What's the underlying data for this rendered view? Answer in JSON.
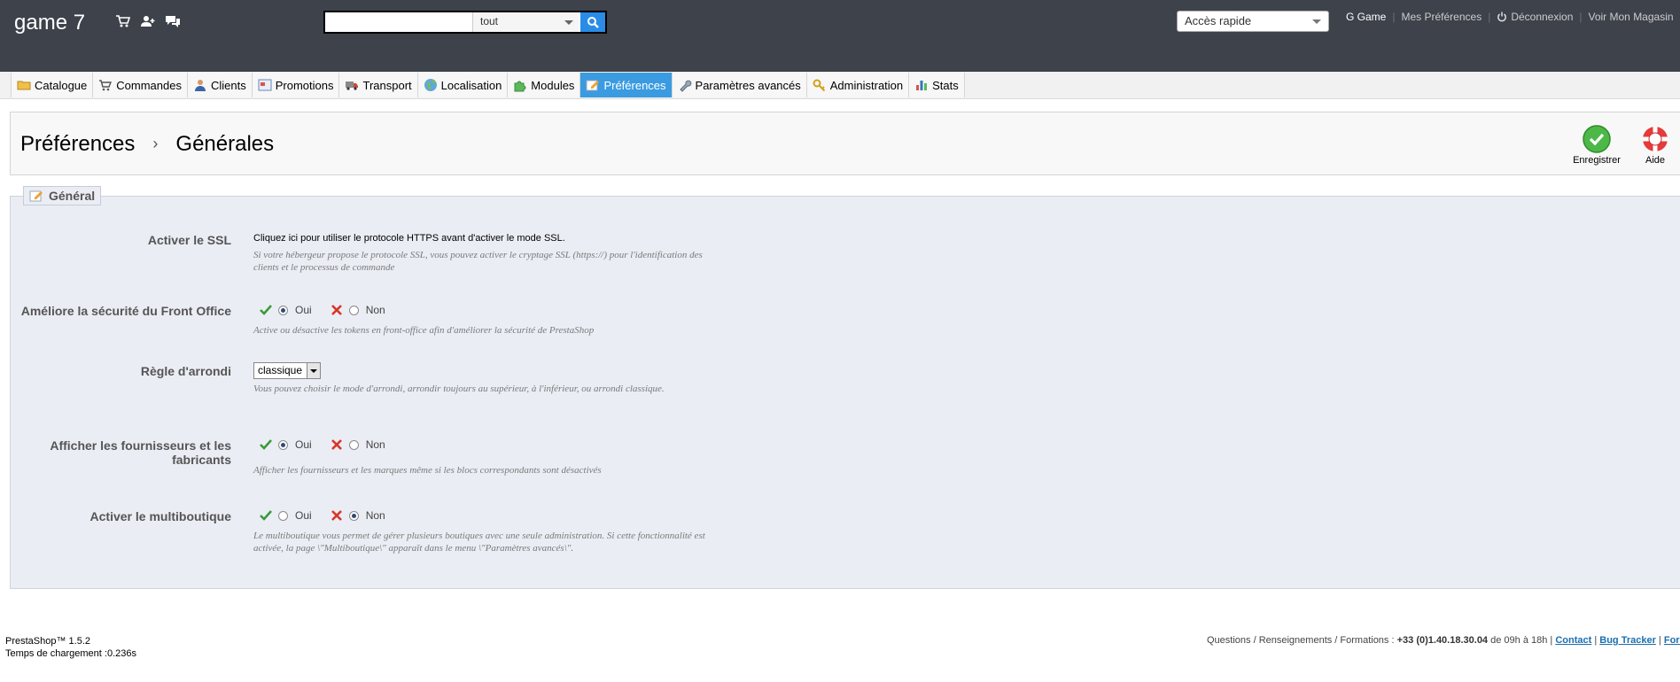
{
  "header": {
    "shop_name": "game 7",
    "search": {
      "value": "",
      "scope": "tout"
    },
    "quick_access": "Accès rapide",
    "links": {
      "user": "G Game",
      "preferences": "Mes Préférences",
      "logout": "Déconnexion",
      "view_shop": "Voir Mon Magasin"
    },
    "icons": [
      "cart-icon",
      "customer-icon",
      "messages-icon"
    ]
  },
  "tabs": [
    {
      "label": "Catalogue",
      "icon": "folder-icon"
    },
    {
      "label": "Commandes",
      "icon": "cart-icon"
    },
    {
      "label": "Clients",
      "icon": "user-icon"
    },
    {
      "label": "Promotions",
      "icon": "promo-icon"
    },
    {
      "label": "Transport",
      "icon": "truck-icon"
    },
    {
      "label": "Localisation",
      "icon": "globe-icon"
    },
    {
      "label": "Modules",
      "icon": "puzzle-icon"
    },
    {
      "label": "Préférences",
      "icon": "preferences-icon",
      "active": true
    },
    {
      "label": "Paramètres avancés",
      "icon": "wrench-icon"
    },
    {
      "label": "Administration",
      "icon": "key-icon"
    },
    {
      "label": "Stats",
      "icon": "chart-icon"
    }
  ],
  "title_bar": {
    "crumb_parent": "Préférences",
    "crumb_current": "Générales",
    "save_label": "Enregistrer",
    "help_label": "Aide"
  },
  "form": {
    "legend": "Général",
    "ssl": {
      "label": "Activer le SSL",
      "link_text": "Cliquez ici pour utiliser le protocole HTTPS avant d'activer le mode SSL.",
      "desc": "Si votre hébergeur propose le protocole SSL, vous pouvez activer le cryptage SSL (https://) pour l'identification des clients et le processus de commande"
    },
    "front_security": {
      "label": "Améliore la sécurité du Front Office",
      "yes": "Oui",
      "no": "Non",
      "value": "yes",
      "desc": "Active ou désactive les tokens en front-office afin d'améliorer la sécurité de PrestaShop"
    },
    "rounding": {
      "label": "Règle d'arrondi",
      "value": "classique",
      "desc": "Vous pouvez choisir le mode d'arrondi, arrondir toujours au supérieur, à l'inférieur, ou arrondi classique."
    },
    "suppliers": {
      "label": "Afficher les fournisseurs et les fabricants",
      "yes": "Oui",
      "no": "Non",
      "value": "yes",
      "desc": "Afficher les fournisseurs et les marques même si les blocs correspondants sont désactivés"
    },
    "multishop": {
      "label": "Activer le multiboutique",
      "yes": "Oui",
      "no": "Non",
      "value": "no",
      "desc": "Le multiboutique vous permet de gérer plusieurs boutiques avec une seule administration. Si cette fonctionnalité est activée, la page \\\"Multiboutique\\\" apparaît dans le menu \\\"Paramètres avancés\\\"."
    }
  },
  "footer": {
    "version": "PrestaShop™ 1.5.2",
    "load_time": "Temps de chargement :0.236s",
    "support_prefix": "Questions / Renseignements / Formations : ",
    "phone": "+33 (0)1.40.18.30.04",
    "hours": " de 09h à 18h | ",
    "contact": "Contact",
    "bug_tracker": "Bug Tracker",
    "forum": "Forum"
  },
  "colors": {
    "header_bg": "#3d424b",
    "active_tab": "#3a9be0",
    "fieldset_bg": "#ebedf4",
    "search_button": "#2a8ce6"
  }
}
